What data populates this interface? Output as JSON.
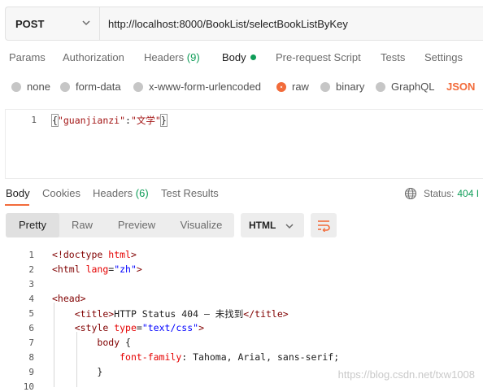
{
  "request": {
    "method": "POST",
    "url": "http://localhost:8000/BookList/selectBookListByKey"
  },
  "request_tabs": [
    {
      "label": "Params"
    },
    {
      "label": "Authorization"
    },
    {
      "label": "Headers",
      "count": "(9)"
    },
    {
      "label": "Body"
    },
    {
      "label": "Pre-request Script"
    },
    {
      "label": "Tests"
    },
    {
      "label": "Settings"
    }
  ],
  "body_types": [
    {
      "label": "none",
      "selected": false
    },
    {
      "label": "form-data",
      "selected": false
    },
    {
      "label": "x-www-form-urlencoded",
      "selected": false
    },
    {
      "label": "raw",
      "selected": true
    },
    {
      "label": "binary",
      "selected": false
    },
    {
      "label": "GraphQL",
      "selected": false
    }
  ],
  "body_format": "JSON",
  "request_body": {
    "line_number": "1",
    "brace_open": "{",
    "key": "\"guanjianzi\"",
    "colon": ":",
    "value": "\"文学\"",
    "brace_close": "}"
  },
  "response_tabs": [
    {
      "label": "Body"
    },
    {
      "label": "Cookies"
    },
    {
      "label": "Headers",
      "count": "(6)"
    },
    {
      "label": "Test Results"
    }
  ],
  "response_status": {
    "label": "Status:",
    "code": "404 I"
  },
  "view_modes": [
    "Pretty",
    "Raw",
    "Preview",
    "Visualize"
  ],
  "active_view_mode": "Pretty",
  "response_language": "HTML",
  "response_lines": [
    {
      "n": "1",
      "html": "<span class='t-doc'>&lt;</span><span class='t-doc'>!doctype</span> <span class='t-attr'>html</span><span class='t-doc'>&gt;</span>"
    },
    {
      "n": "2",
      "html": "<span class='t-tag'>&lt;html</span> <span class='t-attr'>lang</span>=<span class='t-val'>\"zh\"</span><span class='t-tag'>&gt;</span>"
    },
    {
      "n": "3",
      "html": ""
    },
    {
      "n": "4",
      "html": "<span class='t-tag'>&lt;head&gt;</span>"
    },
    {
      "n": "5",
      "html": "    <span class='t-tag'>&lt;title&gt;</span>HTTP Status 404 – 未找到<span class='t-tag'>&lt;/title&gt;</span>"
    },
    {
      "n": "6",
      "html": "    <span class='t-tag'>&lt;style</span> <span class='t-attr'>type</span>=<span class='t-val'>\"text/css\"</span><span class='t-tag'>&gt;</span>"
    },
    {
      "n": "7",
      "html": "        <span class='t-tag'>body</span> {"
    },
    {
      "n": "8",
      "html": "            <span class='t-attr'>font-family</span>: Tahoma, Arial, sans-serif;"
    },
    {
      "n": "9",
      "html": "        }"
    },
    {
      "n": "10",
      "html": ""
    }
  ],
  "watermark": "https://blog.csdn.net/txw1008"
}
